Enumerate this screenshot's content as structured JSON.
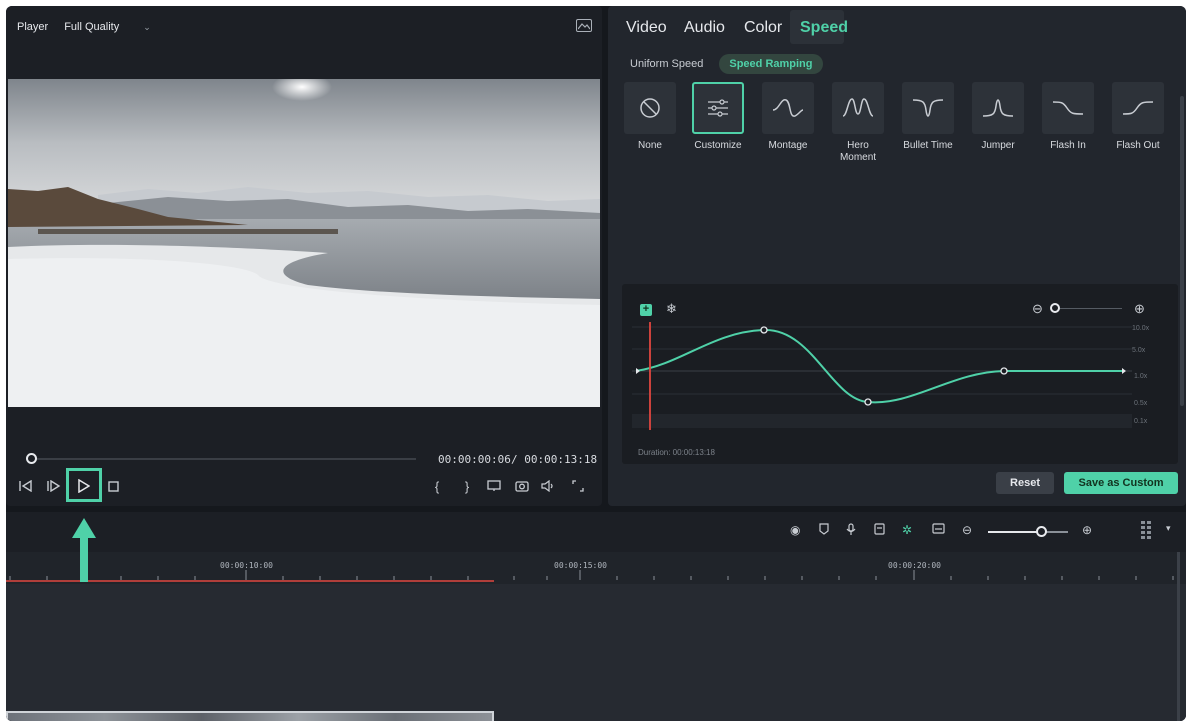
{
  "player": {
    "label": "Player",
    "quality": "Full Quality",
    "current_time": "00:00:00:06",
    "total_time": "/ 00:00:13:18",
    "progress": 0.02
  },
  "props": {
    "tabs": [
      {
        "label": "Video"
      },
      {
        "label": "Audio"
      },
      {
        "label": "Color"
      },
      {
        "label": "Speed",
        "active": true
      }
    ],
    "subtabs": [
      {
        "label": "Uniform Speed"
      },
      {
        "label": "Speed Ramping",
        "active": true
      }
    ],
    "presets": [
      {
        "label": "None",
        "icon": "no-symbol-icon"
      },
      {
        "label": "Customize",
        "icon": "sliders-icon",
        "selected": true
      },
      {
        "label": "Montage",
        "icon": "montage-curve-icon"
      },
      {
        "label": "Hero Moment",
        "icon": "hero-moment-curve-icon"
      },
      {
        "label": "Bullet Time",
        "icon": "bullet-time-curve-icon"
      },
      {
        "label": "Jumper",
        "icon": "jumper-curve-icon"
      },
      {
        "label": "Flash In",
        "icon": "flash-in-curve-icon"
      },
      {
        "label": "Flash Out",
        "icon": "flash-out-curve-icon"
      }
    ],
    "graph": {
      "y_labels": [
        "10.0x",
        "5.0x",
        "1.0x",
        "0.5x",
        "0.1x"
      ],
      "duration": "Duration: 00:00:13:18"
    },
    "reset_label": "Reset",
    "save_label": "Save as Custom"
  },
  "timeline": {
    "ruler": [
      "00:00:10:00",
      "00:00:15:00",
      "00:00:20:00"
    ]
  },
  "colors": {
    "accent": "#4fd1a8",
    "playhead": "#e0463f"
  }
}
